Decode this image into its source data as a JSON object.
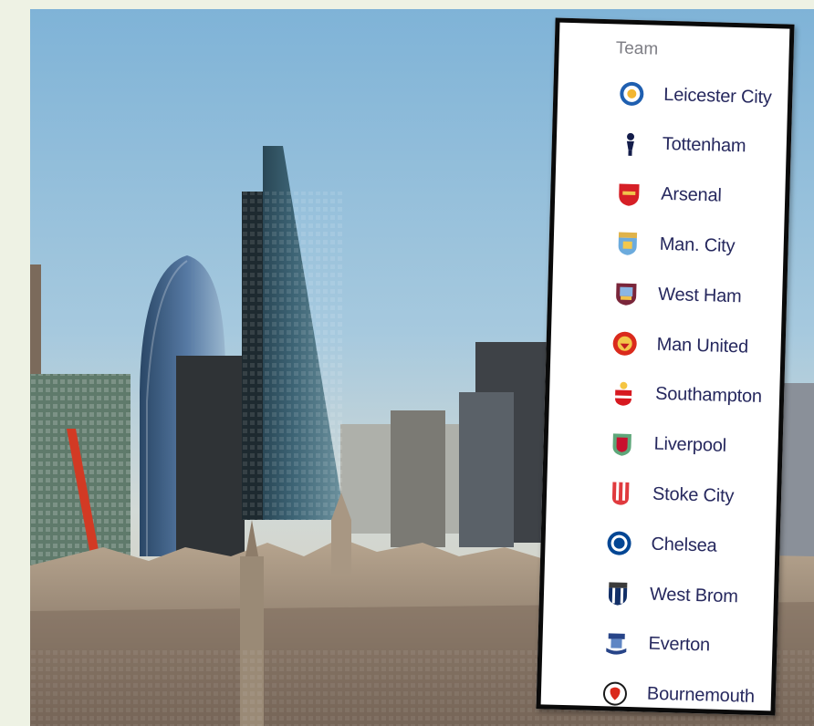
{
  "panel": {
    "header": "Team",
    "teams": [
      {
        "name": "Leicester City",
        "crest": "leicester-crest",
        "color": "#1f5fb0"
      },
      {
        "name": "Tottenham",
        "crest": "tottenham-crest",
        "color": "#131c4a"
      },
      {
        "name": "Arsenal",
        "crest": "arsenal-crest",
        "color": "#d61f26"
      },
      {
        "name": "Man. City",
        "crest": "man-city-crest",
        "color": "#6cabdd"
      },
      {
        "name": "West Ham",
        "crest": "west-ham-crest",
        "color": "#7a263a"
      },
      {
        "name": "Man United",
        "crest": "man-united-crest",
        "color": "#da2a1c"
      },
      {
        "name": "Southampton",
        "crest": "southampton-crest",
        "color": "#d71920"
      },
      {
        "name": "Liverpool",
        "crest": "liverpool-crest",
        "color": "#c8102e"
      },
      {
        "name": "Stoke City",
        "crest": "stoke-city-crest",
        "color": "#e03a3e"
      },
      {
        "name": "Chelsea",
        "crest": "chelsea-crest",
        "color": "#034694"
      },
      {
        "name": "West Brom",
        "crest": "west-brom-crest",
        "color": "#122f67"
      },
      {
        "name": "Everton",
        "crest": "everton-crest",
        "color": "#274488"
      },
      {
        "name": "Bournemouth",
        "crest": "bournemouth-crest",
        "color": "#da291c"
      }
    ]
  }
}
